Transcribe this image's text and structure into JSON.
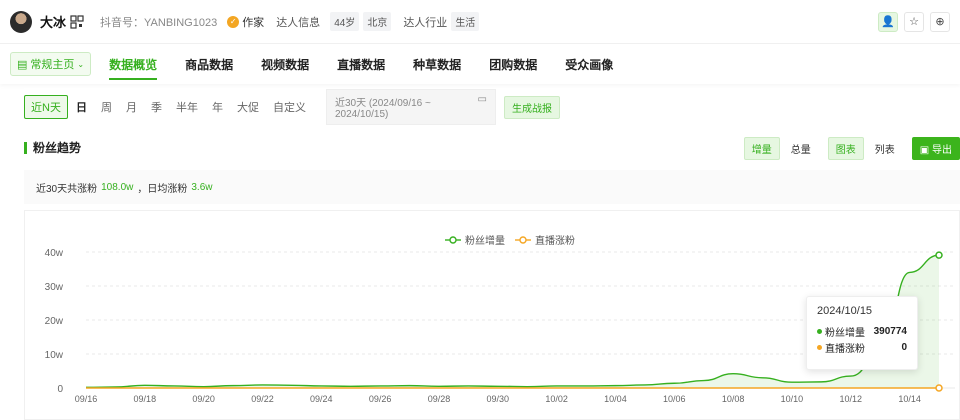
{
  "header": {
    "name": "大冰",
    "douyin_id": "抖音号：YANBING1023",
    "role": "作家",
    "info_label": "达人信息",
    "age": "44岁",
    "city": "北京",
    "industry_label": "达人行业",
    "industry": "生活"
  },
  "tabs": {
    "home": "常规主页",
    "items": [
      "数据概览",
      "商品数据",
      "视频数据",
      "直播数据",
      "种草数据",
      "团购数据",
      "受众画像"
    ]
  },
  "filters": {
    "periods": [
      "近N天",
      "日",
      "周",
      "月",
      "季",
      "半年",
      "年",
      "大促",
      "自定义"
    ],
    "date_range": "近30天 (2024/09/16 ~ 2024/10/15)",
    "generate": "生成战报"
  },
  "section": {
    "title": "粉丝趋势",
    "toggle_increment": "增量",
    "toggle_total": "总量",
    "toggle_chart": "图表",
    "toggle_list": "列表",
    "export": "导出"
  },
  "summary": {
    "prefix": "近30天共涨粉",
    "total": "108.0w",
    "mid": "，日均涨粉",
    "daily": "3.6w"
  },
  "tooltip": {
    "date": "2024/10/15",
    "rows": [
      {
        "label": "粉丝增量",
        "value": "390774"
      },
      {
        "label": "直播涨粉",
        "value": "0"
      }
    ]
  },
  "colors": {
    "accent": "#36b01f",
    "orange": "#f5a623"
  },
  "chart_data": {
    "type": "area",
    "legend": [
      "粉丝增量",
      "直播涨粉"
    ],
    "y_ticks": [
      "0",
      "10w",
      "20w",
      "30w",
      "40w"
    ],
    "ylim": [
      0,
      400000
    ],
    "x_tick_labels": [
      "09/16",
      "09/18",
      "09/20",
      "09/22",
      "09/24",
      "09/26",
      "09/28",
      "09/30",
      "10/02",
      "10/04",
      "10/06",
      "10/08",
      "10/10",
      "10/12",
      "10/14"
    ],
    "x": [
      "09/16",
      "09/17",
      "09/18",
      "09/19",
      "09/20",
      "09/21",
      "09/22",
      "09/23",
      "09/24",
      "09/25",
      "09/26",
      "09/27",
      "09/28",
      "09/29",
      "09/30",
      "10/01",
      "10/02",
      "10/03",
      "10/04",
      "10/05",
      "10/06",
      "10/07",
      "10/08",
      "10/09",
      "10/10",
      "10/11",
      "10/12",
      "10/13",
      "10/14",
      "10/15"
    ],
    "series": [
      {
        "name": "粉丝增量",
        "values": [
          2000,
          3000,
          8000,
          6000,
          4000,
          7000,
          9000,
          8000,
          6000,
          5000,
          6000,
          7000,
          5000,
          6000,
          5000,
          4000,
          6000,
          6000,
          7000,
          9000,
          14000,
          22000,
          42000,
          30000,
          17000,
          18000,
          35000,
          100000,
          340000,
          390774
        ]
      },
      {
        "name": "直播涨粉",
        "values": [
          0,
          0,
          0,
          0,
          0,
          0,
          0,
          0,
          0,
          0,
          0,
          0,
          0,
          0,
          0,
          0,
          0,
          0,
          0,
          0,
          0,
          0,
          0,
          0,
          0,
          0,
          0,
          0,
          0,
          0
        ]
      }
    ]
  }
}
